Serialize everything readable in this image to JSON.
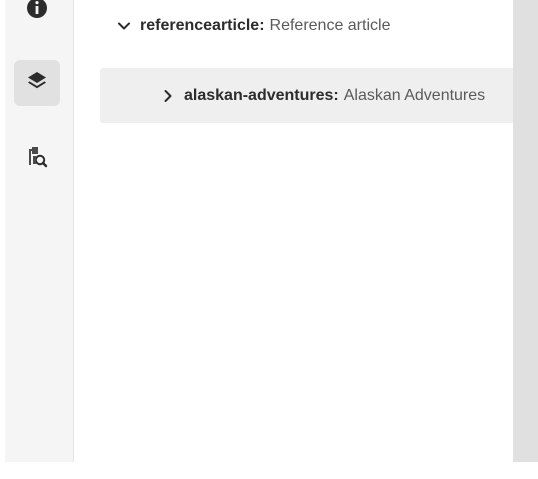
{
  "rail": {
    "items": [
      {
        "icon": "info-icon",
        "selected": false
      },
      {
        "icon": "layers-icon",
        "selected": true
      },
      {
        "icon": "reference-search-icon",
        "selected": false
      }
    ]
  },
  "tree": {
    "root": {
      "name": "referencearticle",
      "separator": ":",
      "title": "Reference article",
      "expanded": true,
      "chevron_icon": "chevron-down-icon"
    },
    "child": {
      "name": "alaskan-adventures",
      "separator": ":",
      "title": "Alaskan Adventures",
      "expanded": false,
      "chevron_icon": "chevron-right-icon"
    }
  },
  "colors": {
    "rail_bg": "#f5f5f5",
    "selected_bg": "#e1e1e1",
    "row_highlight": "#efefef",
    "text_primary": "#2c2c2c",
    "text_secondary": "#5a5a5a",
    "scroll_track": "#e0e0e0"
  }
}
